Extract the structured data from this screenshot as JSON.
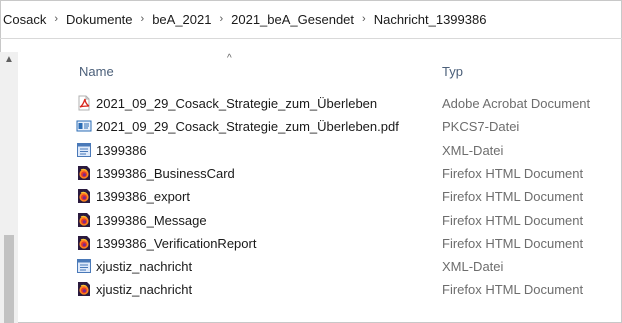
{
  "breadcrumb": [
    "Cosack",
    "Dokumente",
    "beA_2021",
    "2021_beA_Gesendet",
    "Nachricht_1399386"
  ],
  "columns": {
    "name": "Name",
    "type": "Typ"
  },
  "files": [
    {
      "name": "2021_09_29_Cosack_Strategie_zum_Überleben",
      "type": "Adobe Acrobat Document",
      "icon": "pdf-icon"
    },
    {
      "name": "2021_09_29_Cosack_Strategie_zum_Überleben.pdf",
      "type": "PKCS7-Datei",
      "icon": "pkcs7-icon"
    },
    {
      "name": "1399386",
      "type": "XML-Datei",
      "icon": "xml-icon"
    },
    {
      "name": "1399386_BusinessCard",
      "type": "Firefox HTML Document",
      "icon": "firefox-html-icon"
    },
    {
      "name": "1399386_export",
      "type": "Firefox HTML Document",
      "icon": "firefox-html-icon"
    },
    {
      "name": "1399386_Message",
      "type": "Firefox HTML Document",
      "icon": "firefox-html-icon"
    },
    {
      "name": "1399386_VerificationReport",
      "type": "Firefox HTML Document",
      "icon": "firefox-html-icon"
    },
    {
      "name": "xjustiz_nachricht",
      "type": "XML-Datei",
      "icon": "xml-icon"
    },
    {
      "name": "xjustiz_nachricht",
      "type": "Firefox HTML Document",
      "icon": "firefox-html-icon"
    }
  ]
}
